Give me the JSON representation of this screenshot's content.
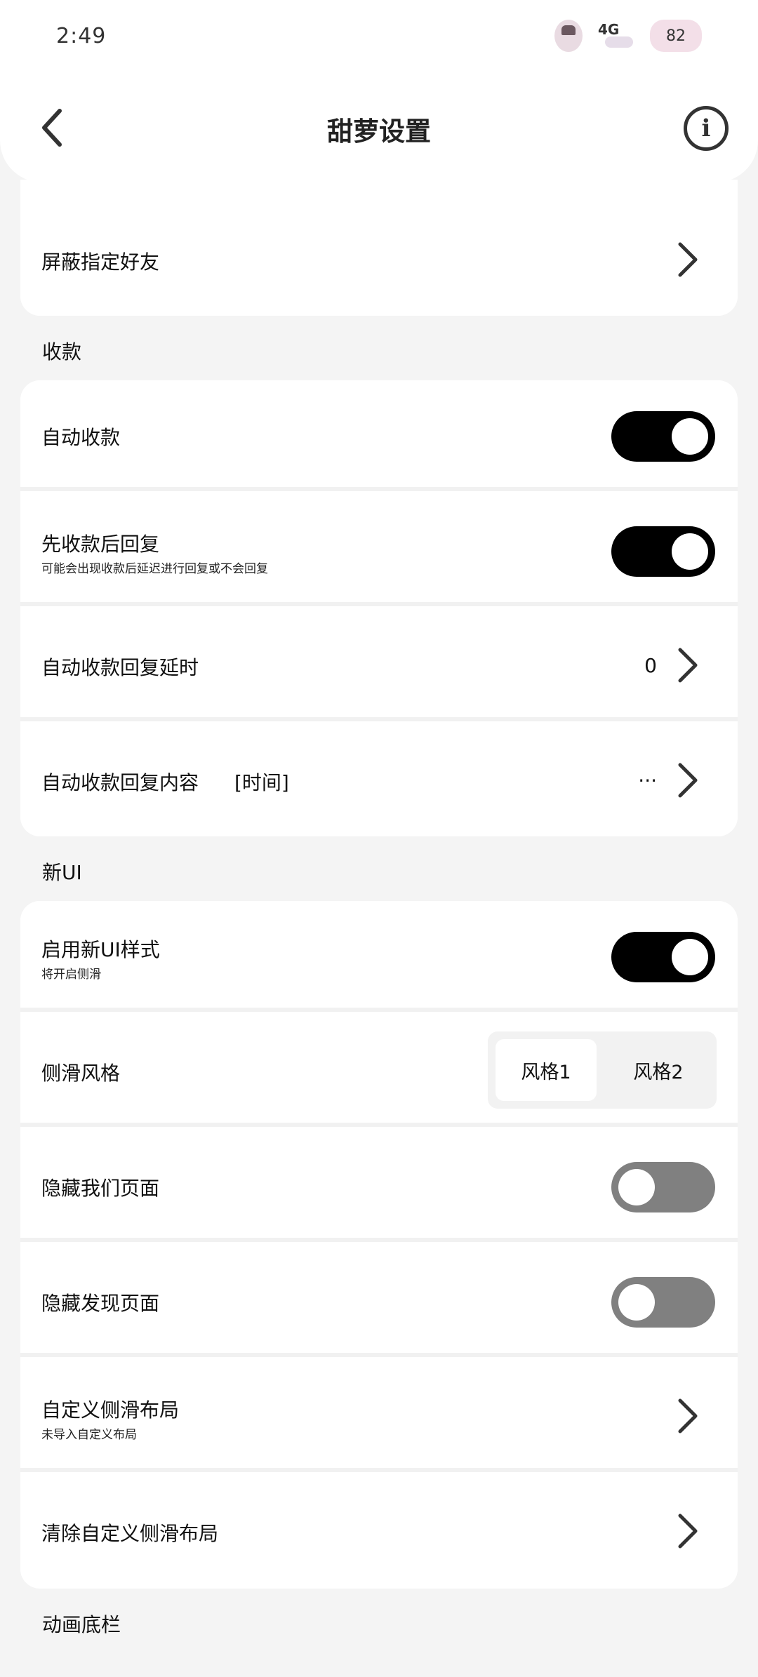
{
  "status": {
    "time": "2:49",
    "network": "4G",
    "battery": "82"
  },
  "header": {
    "title": "甜萝设置"
  },
  "sections": {
    "shield_friend": {
      "title": "屏蔽指定好友"
    },
    "payment": {
      "label": "收款",
      "auto_collect": {
        "title": "自动收款",
        "on": true
      },
      "collect_then_reply": {
        "title": "先收款后回复",
        "subtitle": "可能会出现收款后延迟进行回复或不会回复",
        "on": true
      },
      "reply_delay": {
        "title": "自动收款回复延时",
        "value": "0"
      },
      "reply_content": {
        "title": "自动收款回复内容",
        "tag": "[时间]",
        "value": "···"
      }
    },
    "new_ui": {
      "label": "新UI",
      "enable_new_ui": {
        "title": "启用新UI样式",
        "subtitle": "将开启侧滑",
        "on": true
      },
      "slide_style": {
        "title": "侧滑风格",
        "options": [
          "风格1",
          "风格2"
        ],
        "selected": "风格1"
      },
      "hide_me_page": {
        "title": "隐藏我们页面",
        "on": false
      },
      "hide_discover_page": {
        "title": "隐藏发现页面",
        "on": false
      },
      "custom_slide_layout": {
        "title": "自定义侧滑布局",
        "subtitle": "未导入自定义布局"
      },
      "clear_slide_layout": {
        "title": "清除自定义侧滑布局"
      }
    },
    "anim_bottom_bar": {
      "label": "动画底栏"
    }
  }
}
